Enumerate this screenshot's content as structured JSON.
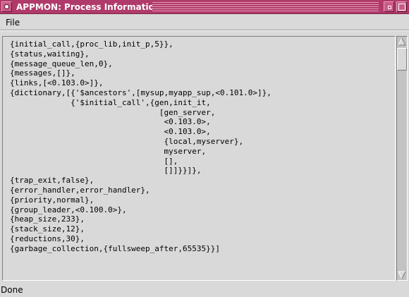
{
  "window": {
    "title": "APPMON: Process Information",
    "title_bar_color": "#b03a6a"
  },
  "menubar": {
    "items": [
      {
        "label": "File"
      }
    ]
  },
  "content": {
    "lines": [
      "{initial_call,{proc_lib,init_p,5}},",
      "{status,waiting},",
      "{message_queue_len,0},",
      "{messages,[]},",
      "{links,[<0.103.0>]},",
      "{dictionary,[{'$ancestors',[mysup,myapp_sup,<0.101.0>]},",
      "             {'$initial_call',{gen,init_it,",
      "                                [gen_server,",
      "                                 <0.103.0>,",
      "                                 <0.103.0>,",
      "                                 {local,myserver},",
      "                                 myserver,",
      "                                 [],",
      "                                 []]}}]},",
      "{trap_exit,false},",
      "{error_handler,error_handler},",
      "{priority,normal},",
      "{group_leader,<0.100.0>},",
      "{heap_size,233},",
      "{stack_size,12},",
      "{reductions,30},",
      "{garbage_collection,{fullsweep_after,65535}}]"
    ]
  },
  "statusbar": {
    "text": "Done"
  },
  "icons": {
    "window_menu": "window-menu-icon",
    "minimize": "minimize-icon",
    "maximize": "maximize-icon",
    "scroll_up": "arrow-up-icon",
    "scroll_down": "arrow-down-icon"
  }
}
